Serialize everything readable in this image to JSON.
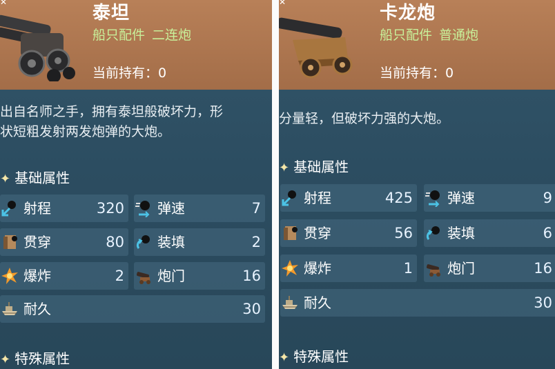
{
  "colors": {
    "header": "#a97250",
    "panel": "#2e4f63",
    "subtitle": "#c8f09a",
    "star": "#f5e6a8"
  },
  "cards": [
    {
      "name": "泰坦",
      "category": "船只配件",
      "subtype": "二连炮",
      "owned_label": "当前持有：",
      "owned_value": "0",
      "description_lines": [
        "出自名师之手，拥有泰坦般破坏力，形",
        "状短粗发射两发炮弹的大炮。"
      ],
      "basic_section": "基础属性",
      "special_section": "特殊属性",
      "stats": {
        "range": {
          "label": "射程",
          "value": "320",
          "icon": "range-icon"
        },
        "speed": {
          "label": "弹速",
          "value": "7",
          "icon": "shell-speed-icon"
        },
        "pierce": {
          "label": "贯穿",
          "value": "80",
          "icon": "pierce-icon"
        },
        "reload": {
          "label": "装填",
          "value": "2",
          "icon": "reload-icon"
        },
        "blast": {
          "label": "爆炸",
          "value": "2",
          "icon": "explosion-icon"
        },
        "ports": {
          "label": "炮门",
          "value": "16",
          "icon": "cannon-port-icon"
        },
        "durability": {
          "label": "耐久",
          "value": "30",
          "icon": "durability-icon"
        }
      }
    },
    {
      "name": "卡龙炮",
      "category": "船只配件",
      "subtype": "普通炮",
      "owned_label": "当前持有：",
      "owned_value": "0",
      "description_lines": [
        "分量轻，但破坏力强的大炮。"
      ],
      "basic_section": "基础属性",
      "special_section": "特殊属性",
      "stats": {
        "range": {
          "label": "射程",
          "value": "425",
          "icon": "range-icon"
        },
        "speed": {
          "label": "弹速",
          "value": "9",
          "icon": "shell-speed-icon"
        },
        "pierce": {
          "label": "贯穿",
          "value": "56",
          "icon": "pierce-icon"
        },
        "reload": {
          "label": "装填",
          "value": "6",
          "icon": "reload-icon"
        },
        "blast": {
          "label": "爆炸",
          "value": "1",
          "icon": "explosion-icon"
        },
        "ports": {
          "label": "炮门",
          "value": "16",
          "icon": "cannon-port-icon"
        },
        "durability": {
          "label": "耐久",
          "value": "30",
          "icon": "durability-icon"
        }
      }
    }
  ]
}
